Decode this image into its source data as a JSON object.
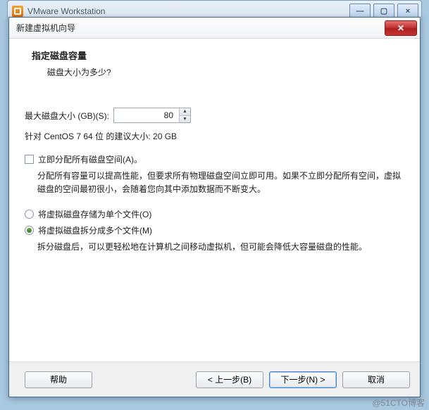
{
  "app": {
    "title": "VMware Workstation",
    "min_glyph": "—",
    "max_glyph": "▢",
    "close_glyph": "×"
  },
  "dialog": {
    "title": "新建虚拟机向导",
    "close_glyph": "✕",
    "heading": "指定磁盘容量",
    "subheading": "磁盘大小为多少?",
    "disk_size_label": "最大磁盘大小 (GB)(S):",
    "disk_size_value": "80",
    "recommended": "针对 CentOS 7 64 位 的建议大小: 20 GB",
    "allocate_now_label": "立即分配所有磁盘空间(A)。",
    "allocate_now_desc": "分配所有容量可以提高性能，但要求所有物理磁盘空间立即可用。如果不立即分配所有空间，虚拟磁盘的空间最初很小，会随着您向其中添加数据而不断变大。",
    "radio_single_label": "将虚拟磁盘存储为单个文件(O)",
    "radio_split_label": "将虚拟磁盘拆分成多个文件(M)",
    "split_desc": "拆分磁盘后，可以更轻松地在计算机之间移动虚拟机，但可能会降低大容量磁盘的性能。",
    "buttons": {
      "help": "帮助",
      "back": "< 上一步(B)",
      "next": "下一步(N) >",
      "cancel": "取消"
    },
    "selected_radio": "split"
  },
  "watermark": "@51CTO博客"
}
